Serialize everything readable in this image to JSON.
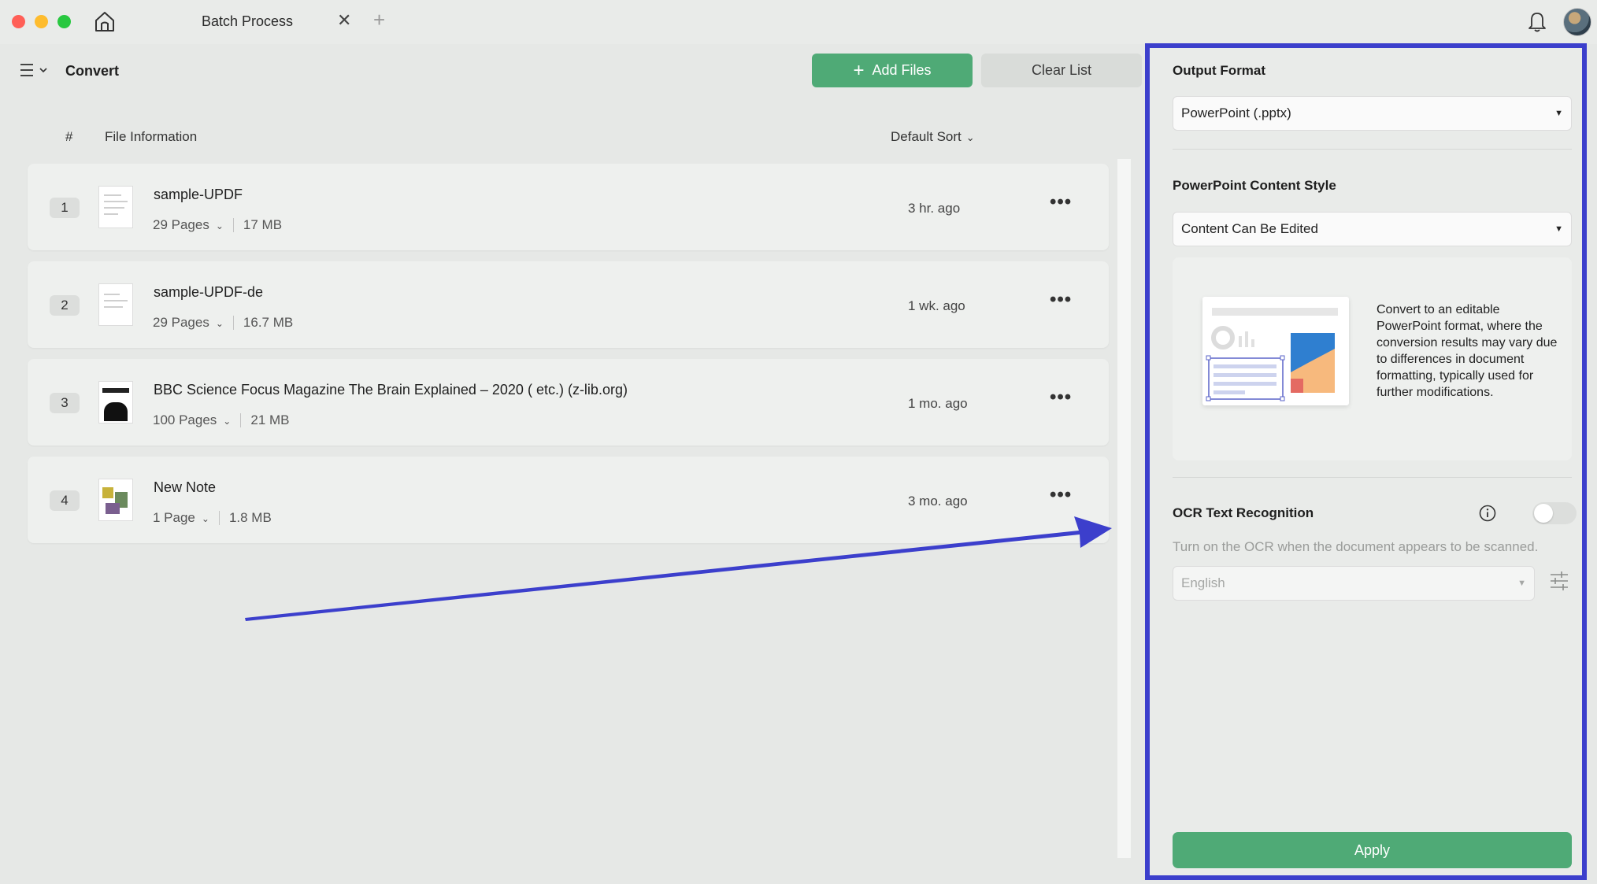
{
  "window": {
    "tab_title": "Batch Process",
    "tab_close": "✕",
    "tab_add": "+"
  },
  "toolbar": {
    "title": "Convert",
    "add_files_icon": "+",
    "add_files_label": "Add Files",
    "clear_list_label": "Clear List"
  },
  "table": {
    "col_number": "#",
    "col_info": "File Information",
    "sort_label": "Default Sort",
    "rows": [
      {
        "num": "1",
        "name": "sample-UPDF",
        "pages": "29 Pages",
        "size": "17 MB",
        "time": "3 hr. ago"
      },
      {
        "num": "2",
        "name": "sample-UPDF-de",
        "pages": "29 Pages",
        "size": "16.7 MB",
        "time": "1 wk. ago"
      },
      {
        "num": "3",
        "name": "BBC Science Focus Magazine The Brain Explained – 2020 ( etc.) (z-lib.org)",
        "pages": "100 Pages",
        "size": "21 MB",
        "time": "1 mo. ago"
      },
      {
        "num": "4",
        "name": "New Note",
        "pages": "1 Page",
        "size": "1.8 MB",
        "time": "3 mo. ago"
      }
    ],
    "more_glyph": "•••"
  },
  "panel": {
    "output_format_label": "Output Format",
    "output_format_value": "PowerPoint (.pptx)",
    "content_style_label": "PowerPoint Content Style",
    "content_style_value": "Content Can Be Edited",
    "description": "Convert to an editable PowerPoint format, where the conversion results may vary due to differences in document formatting, typically used for further modifications.",
    "ocr_label": "OCR Text Recognition",
    "ocr_enabled": false,
    "ocr_hint": "Turn on the OCR when the document appears to be scanned.",
    "ocr_language": "English",
    "apply_label": "Apply"
  },
  "colors": {
    "accent_green": "#4faa76",
    "annotation_blue": "#3c3fcc"
  },
  "icons": [
    "home-icon",
    "close-icon",
    "plus-icon",
    "bell-icon",
    "menu-icon",
    "chevron-down-icon",
    "more-icon",
    "info-icon",
    "settings-sliders-icon",
    "caret-down-icon"
  ]
}
